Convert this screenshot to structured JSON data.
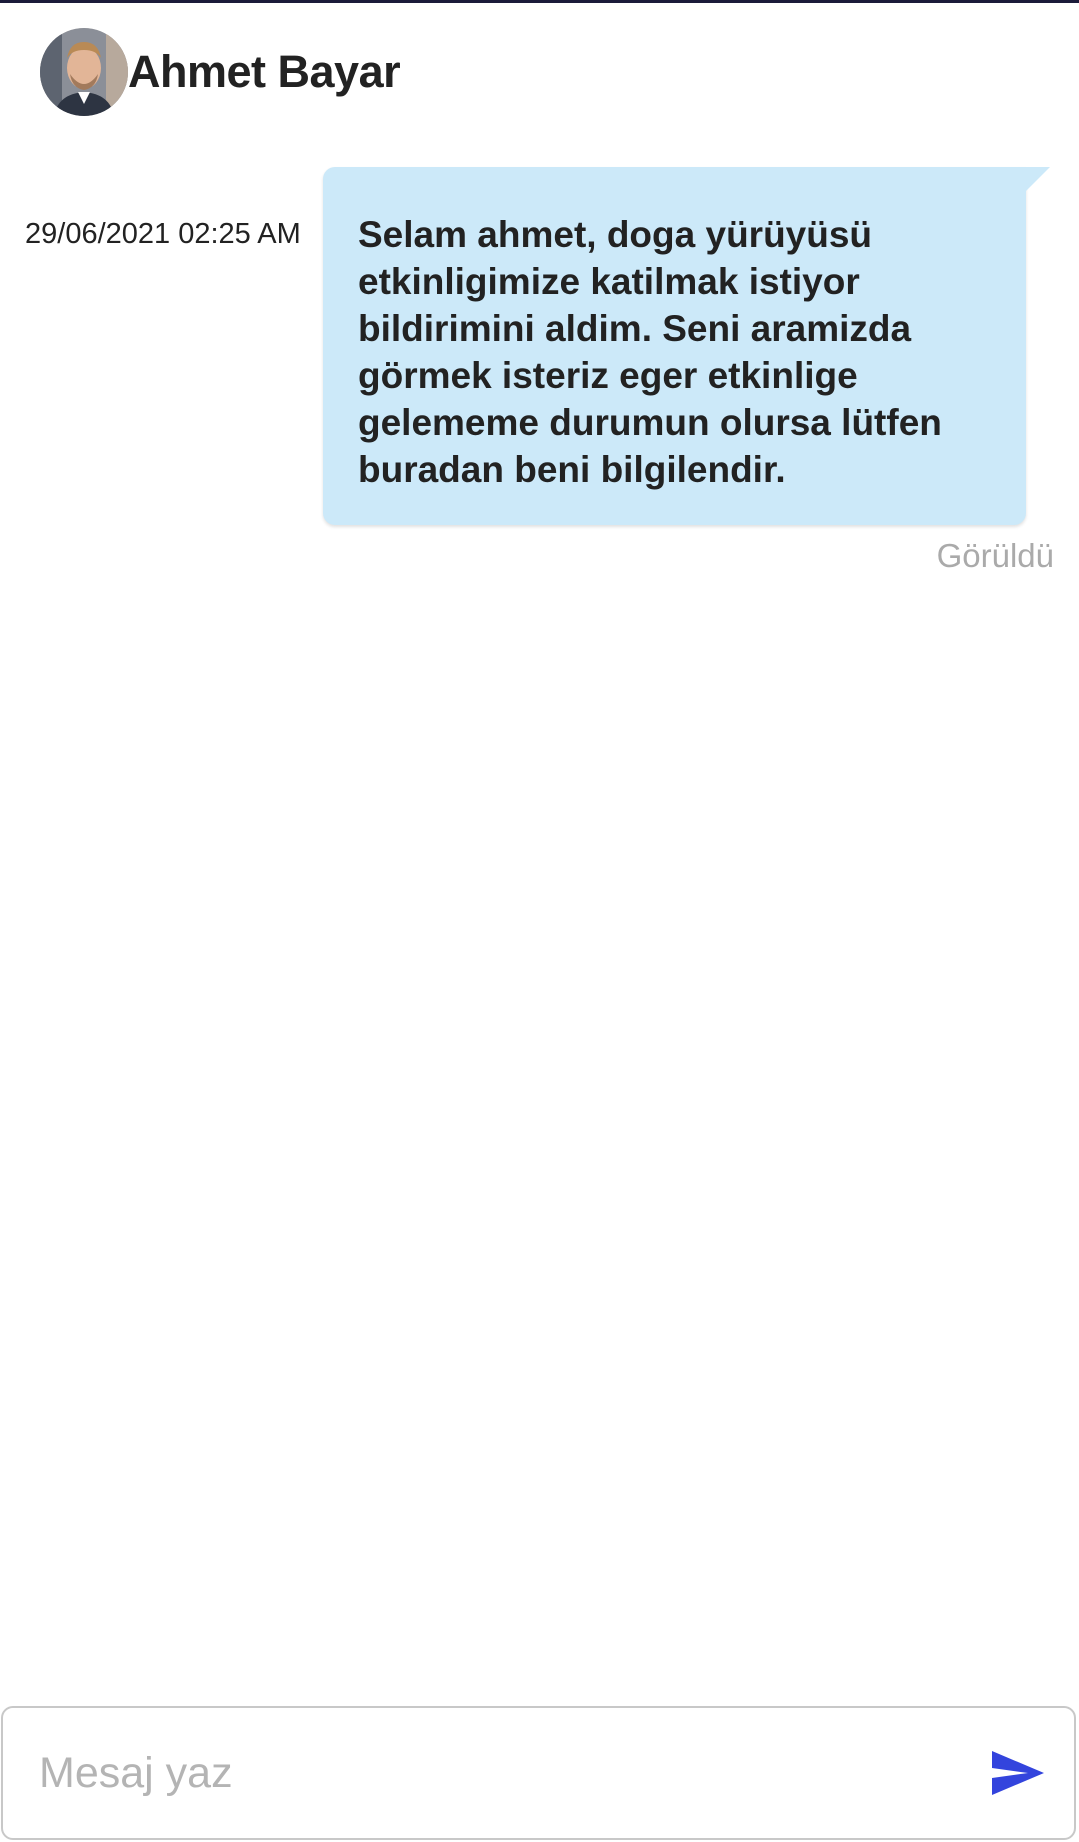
{
  "colors": {
    "bubble": "#cce9f9",
    "accent": "#3344dd",
    "seen": "#aaaaaa",
    "text": "#222222"
  },
  "header": {
    "contact_name": "Ahmet Bayar",
    "avatar_icon": "avatar-photo"
  },
  "messages": [
    {
      "timestamp": "29/06/2021 02:25 AM",
      "text": "Selam ahmet, doga yürüyüsü etkinligimize katilmak istiyor bildirimini aldim. Seni aramizda görmek isteriz eger etkinlige gelememe durumun olursa lütfen buradan beni bilgilendir.",
      "status": "Görüldü"
    }
  ],
  "composer": {
    "placeholder": "Mesaj yaz",
    "value": "",
    "send_icon": "send-icon"
  }
}
